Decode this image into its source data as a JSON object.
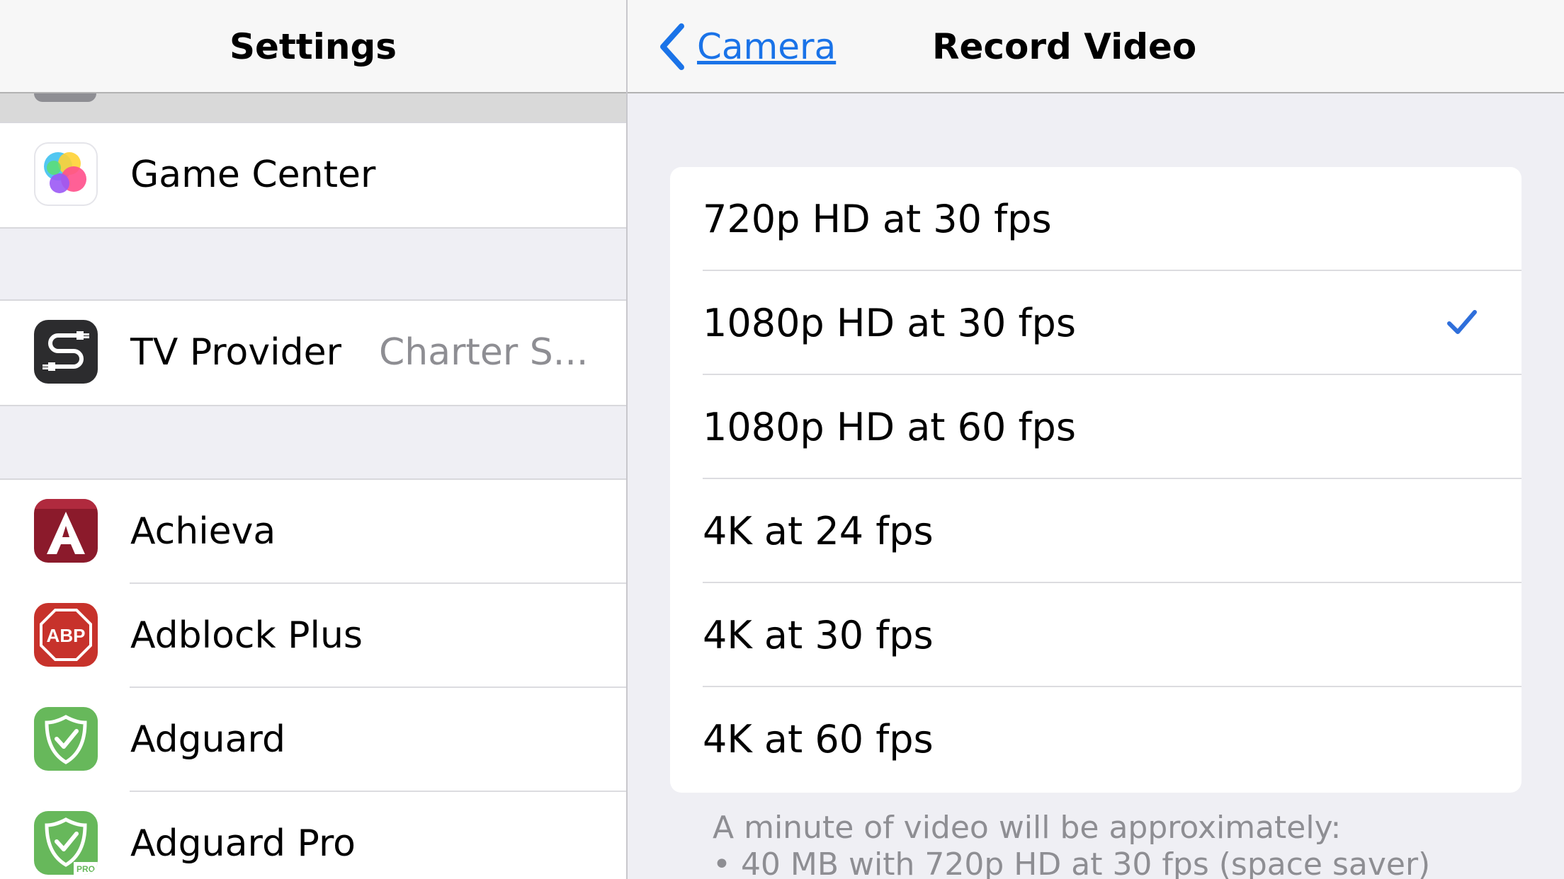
{
  "left": {
    "nav_title": "Settings",
    "groups": [
      {
        "items": [
          {
            "label": "Game Center",
            "value": "",
            "icon": "game-center-icon"
          }
        ]
      },
      {
        "items": [
          {
            "label": "TV Provider",
            "value": "Charter S...",
            "icon": "tv-provider-icon"
          }
        ]
      },
      {
        "items": [
          {
            "label": "Achieva",
            "value": "",
            "icon": "achieva-app-icon"
          },
          {
            "label": "Adblock Plus",
            "value": "",
            "icon": "adblock-plus-icon",
            "icon_text": "ABP"
          },
          {
            "label": "Adguard",
            "value": "",
            "icon": "adguard-icon"
          },
          {
            "label": "Adguard Pro",
            "value": "",
            "icon": "adguard-pro-icon",
            "icon_badge": "PRO"
          }
        ]
      }
    ]
  },
  "right": {
    "back_label": "Camera",
    "nav_title": "Record Video",
    "options": [
      {
        "label": "720p HD at 30 fps",
        "selected": false
      },
      {
        "label": "1080p HD at 30 fps",
        "selected": true
      },
      {
        "label": "1080p HD at 60 fps",
        "selected": false
      },
      {
        "label": "4K at 24 fps",
        "selected": false
      },
      {
        "label": "4K at 30 fps",
        "selected": false
      },
      {
        "label": "4K at 60 fps",
        "selected": false
      }
    ],
    "footer": {
      "line1": "A minute of video will be approximately:",
      "line2": "• 40 MB with 720p HD at 30 fps (space saver)"
    }
  },
  "colors": {
    "accent": "#1a73e8",
    "checkmark": "#2f6fdb",
    "background": "#efeff4",
    "secondary_text": "#8e8e93"
  }
}
